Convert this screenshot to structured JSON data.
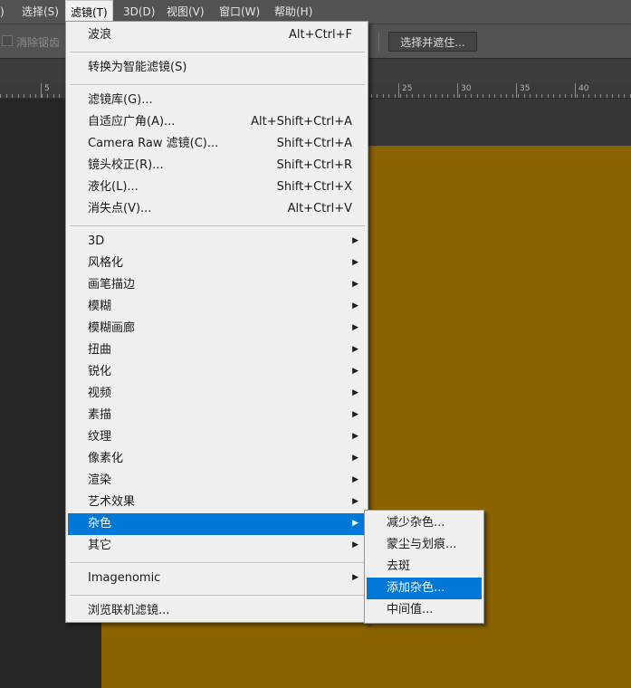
{
  "menubar": {
    "items": [
      ")",
      "选择(S)",
      "滤镜(T)",
      "3D(D)",
      "视图(V)",
      "窗口(W)",
      "帮助(H)"
    ]
  },
  "options": {
    "antialias_label": "消除锯齿",
    "select_mask_button": "选择并遮住..."
  },
  "ruler": {
    "labels": [
      "5",
      "25",
      "30",
      "35",
      "40"
    ]
  },
  "document": {
    "fill_color": "#8b6200"
  },
  "filter_menu": {
    "groups": [
      [
        {
          "label": "波浪",
          "shortcut": "Alt+Ctrl+F"
        }
      ],
      [
        {
          "label": "转换为智能滤镜(S)",
          "shortcut": ""
        }
      ],
      [
        {
          "label": "滤镜库(G)...",
          "shortcut": ""
        },
        {
          "label": "自适应广角(A)...",
          "shortcut": "Alt+Shift+Ctrl+A"
        },
        {
          "label": "Camera Raw 滤镜(C)...",
          "shortcut": "Shift+Ctrl+A"
        },
        {
          "label": "镜头校正(R)...",
          "shortcut": "Shift+Ctrl+R"
        },
        {
          "label": "液化(L)...",
          "shortcut": "Shift+Ctrl+X"
        },
        {
          "label": "消失点(V)...",
          "shortcut": "Alt+Ctrl+V"
        }
      ],
      [
        {
          "label": "3D",
          "submenu": true
        },
        {
          "label": "风格化",
          "submenu": true
        },
        {
          "label": "画笔描边",
          "submenu": true
        },
        {
          "label": "模糊",
          "submenu": true
        },
        {
          "label": "模糊画廊",
          "submenu": true
        },
        {
          "label": "扭曲",
          "submenu": true
        },
        {
          "label": "锐化",
          "submenu": true
        },
        {
          "label": "视频",
          "submenu": true
        },
        {
          "label": "素描",
          "submenu": true
        },
        {
          "label": "纹理",
          "submenu": true
        },
        {
          "label": "像素化",
          "submenu": true
        },
        {
          "label": "渲染",
          "submenu": true
        },
        {
          "label": "艺术效果",
          "submenu": true
        },
        {
          "label": "杂色",
          "submenu": true,
          "highlighted": true
        },
        {
          "label": "其它",
          "submenu": true
        }
      ],
      [
        {
          "label": "Imagenomic",
          "submenu": true
        }
      ],
      [
        {
          "label": "浏览联机滤镜...",
          "shortcut": ""
        }
      ]
    ]
  },
  "noise_submenu": {
    "items": [
      {
        "label": "减少杂色..."
      },
      {
        "label": "蒙尘与划痕..."
      },
      {
        "label": "去斑"
      },
      {
        "label": "添加杂色...",
        "highlighted": true
      },
      {
        "label": "中间值..."
      }
    ]
  }
}
